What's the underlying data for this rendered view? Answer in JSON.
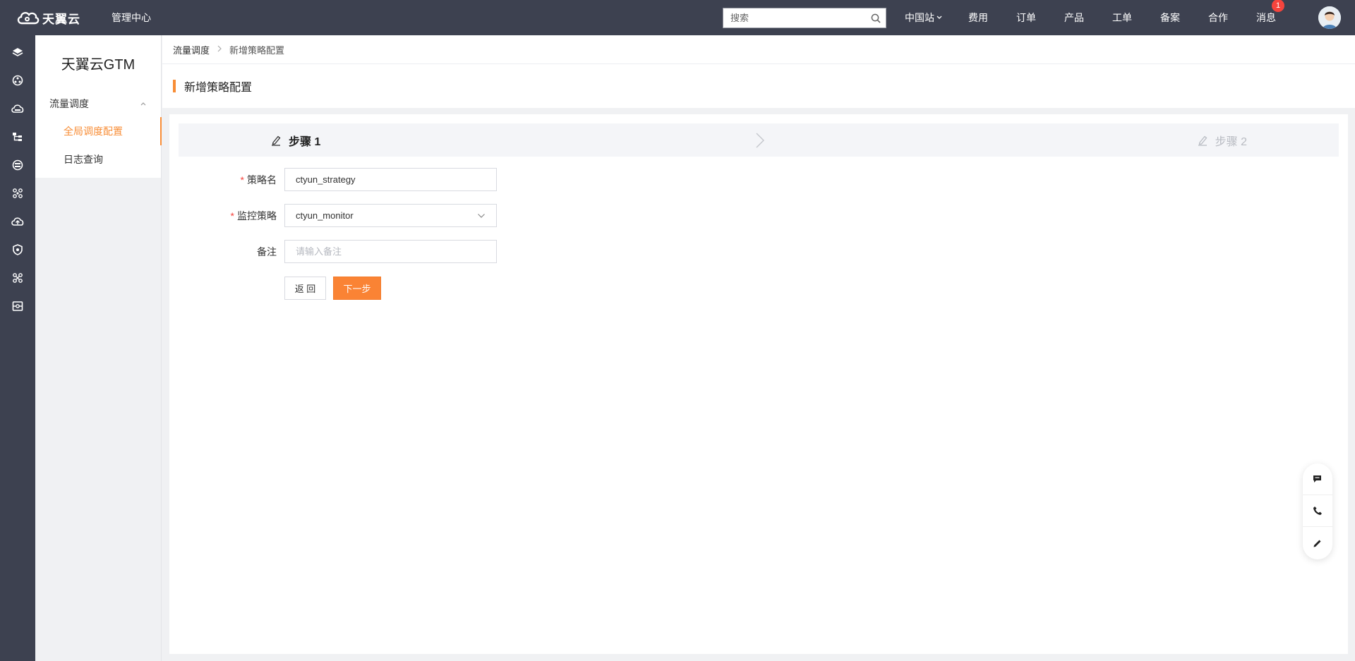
{
  "topbar": {
    "brand": "天翼云",
    "console_label": "管理中心",
    "search_placeholder": "搜索",
    "region": "中国站",
    "nav": [
      "费用",
      "订单",
      "产品",
      "工单",
      "备案",
      "合作"
    ],
    "messages_label": "消息",
    "messages_badge": "1"
  },
  "rail": {
    "icons": [
      "layers-icon",
      "network-icon",
      "cloud-icon",
      "org-chart-icon",
      "database-icon",
      "cluster-icon",
      "cloud-upload-icon",
      "shield-icon",
      "nodes-icon",
      "monitor-icon"
    ]
  },
  "sidebar": {
    "title": "天翼云GTM",
    "group": "流量调度",
    "items": [
      {
        "label": "全局调度配置",
        "active": true
      },
      {
        "label": "日志查询",
        "active": false
      }
    ]
  },
  "breadcrumb": {
    "parent": "流量调度",
    "current": "新增策略配置"
  },
  "page": {
    "title": "新增策略配置"
  },
  "steps": {
    "step1": "步骤 1",
    "step2": "步骤 2"
  },
  "form": {
    "name_label": "策略名",
    "name_value": "ctyun_strategy",
    "monitor_label": "监控策略",
    "monitor_value": "ctyun_monitor",
    "remark_label": "备注",
    "remark_placeholder": "请输入备注",
    "back_label": "返 回",
    "next_label": "下一步"
  },
  "colors": {
    "accent": "#fa8334",
    "topbar": "#3d4150",
    "required": "#f5443d"
  }
}
